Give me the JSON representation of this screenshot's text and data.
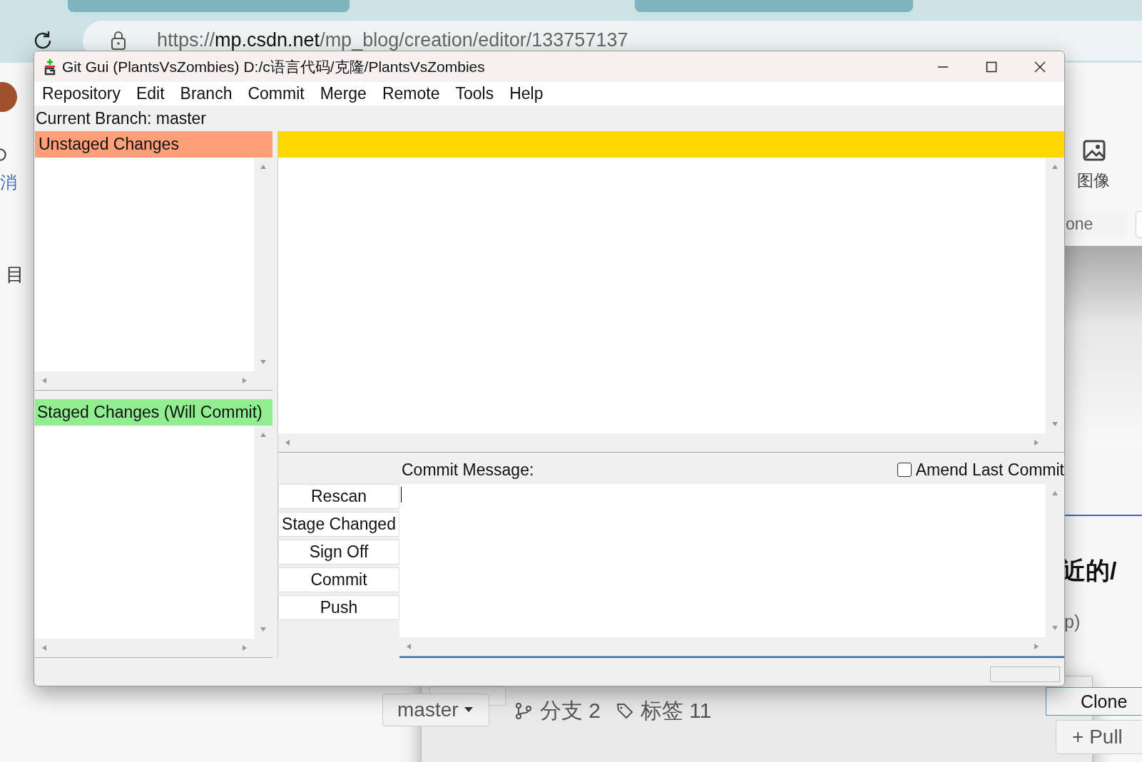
{
  "browser": {
    "url": {
      "scheme": "https://",
      "host": "mp.csdn.net",
      "path": "/mp_blog/creation/editor/133757137"
    }
  },
  "page_behind": {
    "left_texts": [
      "消",
      "目"
    ],
    "image_tool": "图像",
    "field_value": "one",
    "heading": "近的/",
    "note": "p)",
    "clone_button": "Clone",
    "branch_select": "master",
    "branch_count": "分支 2",
    "tag_count": "标签 11",
    "pull_button": "+ Pull"
  },
  "git_window": {
    "title": "Git Gui (PlantsVsZombies) D:/c语言代码/克隆/PlantsVsZombies",
    "menu": [
      "Repository",
      "Edit",
      "Branch",
      "Commit",
      "Merge",
      "Remote",
      "Tools",
      "Help"
    ],
    "current_branch": "Current Branch: master",
    "unstaged_header": "Unstaged Changes",
    "staged_header": "Staged Changes (Will Commit)",
    "commit_message_label": "Commit Message:",
    "amend": {
      "label": "Amend Last Commit",
      "checked": false
    },
    "buttons": [
      "Rescan",
      "Stage Changed",
      "Sign Off",
      "Commit",
      "Push"
    ]
  }
}
